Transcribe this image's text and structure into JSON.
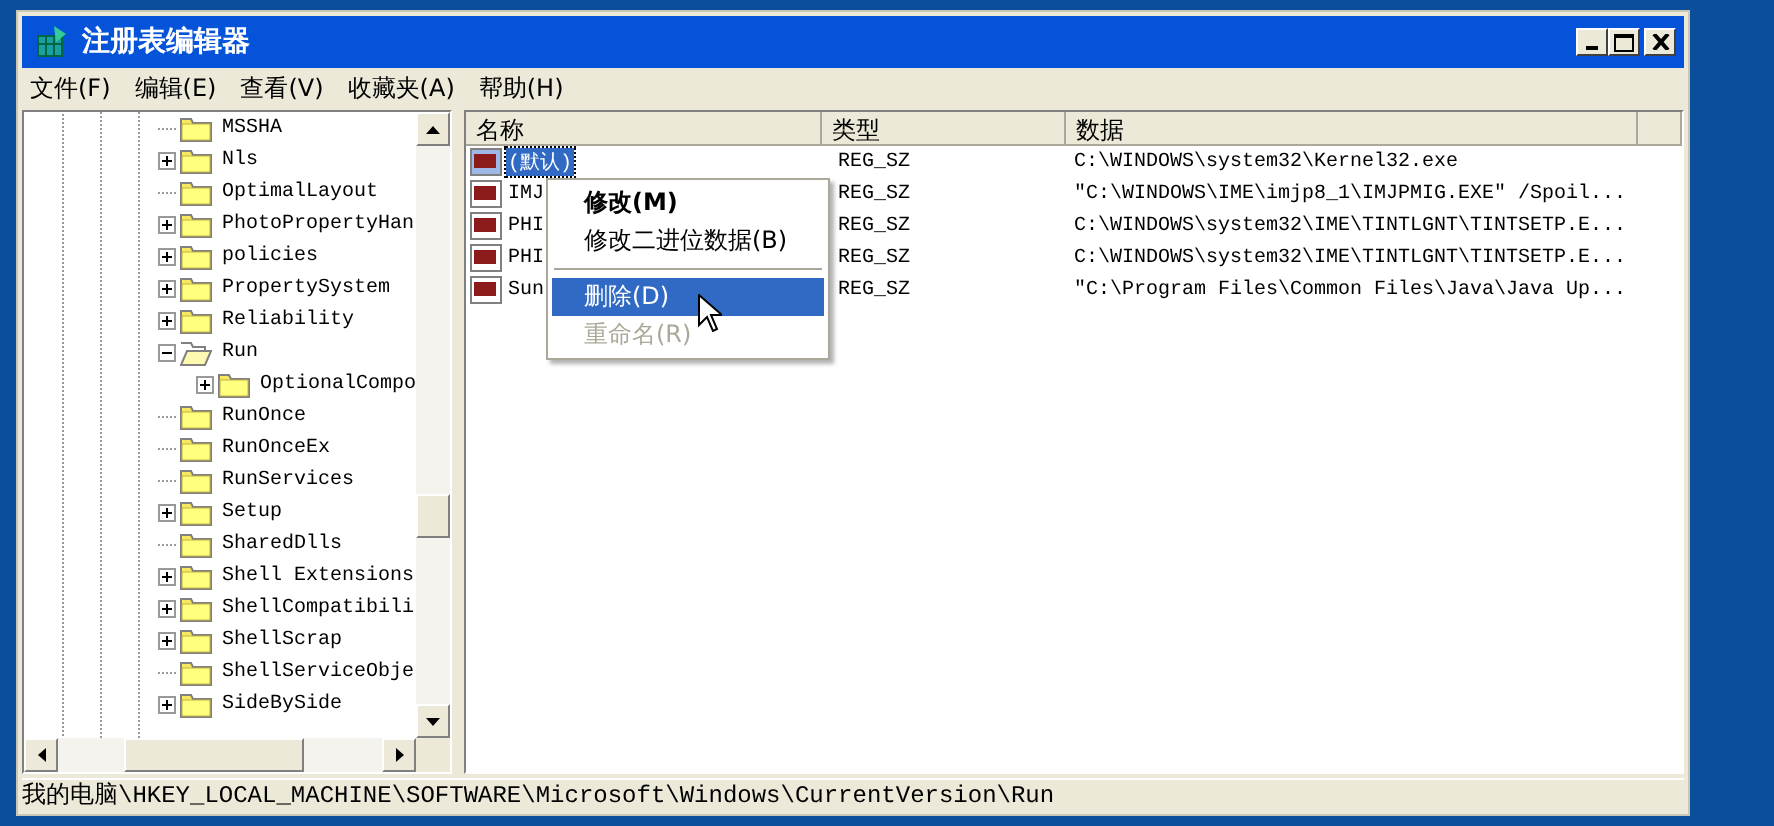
{
  "window": {
    "title": "注册表编辑器"
  },
  "menu": [
    {
      "label": "文件(F)"
    },
    {
      "label": "编辑(E)"
    },
    {
      "label": "查看(V)"
    },
    {
      "label": "收藏夹(A)"
    },
    {
      "label": "帮助(H)"
    }
  ],
  "tree": [
    {
      "label": "MSSHA"
    },
    {
      "label": "Nls",
      "expanded": false
    },
    {
      "label": "OptimalLayout"
    },
    {
      "label": "PhotoPropertyHan",
      "expanded": false
    },
    {
      "label": "policies",
      "expanded": false
    },
    {
      "label": "PropertySystem",
      "expanded": false
    },
    {
      "label": "Reliability",
      "expanded": false
    },
    {
      "label": "Run",
      "expanded": true,
      "children": [
        {
          "label": "OptionalCompo",
          "expanded": false
        }
      ]
    },
    {
      "label": "RunOnce"
    },
    {
      "label": "RunOnceEx"
    },
    {
      "label": "RunServices"
    },
    {
      "label": "Setup",
      "expanded": false
    },
    {
      "label": "SharedDlls"
    },
    {
      "label": "Shell Extensions",
      "expanded": false
    },
    {
      "label": "ShellCompatibili",
      "expanded": false
    },
    {
      "label": "ShellScrap",
      "expanded": false
    },
    {
      "label": "ShellServiceObje"
    },
    {
      "label": "SideBySide",
      "expanded": false
    }
  ],
  "table": {
    "columns": [
      "名称",
      "类型",
      "数据"
    ],
    "rows": [
      {
        "name": "(默认)",
        "type": "REG_SZ",
        "data": "C:\\WINDOWS\\system32\\Kernel32.exe",
        "selected": true
      },
      {
        "name": "IMJ",
        "type": "REG_SZ",
        "data": "\"C:\\WINDOWS\\IME\\imjp8_1\\IMJPMIG.EXE\" /Spoil...",
        "selected": false
      },
      {
        "name": "PHI",
        "type": "REG_SZ",
        "data": "C:\\WINDOWS\\system32\\IME\\TINTLGNT\\TINTSETP.E...",
        "selected": false
      },
      {
        "name": "PHI",
        "type": "REG_SZ",
        "data": "C:\\WINDOWS\\system32\\IME\\TINTLGNT\\TINTSETP.E...",
        "selected": false
      },
      {
        "name": "Sun",
        "type": "REG_SZ",
        "data": "\"C:\\Program Files\\Common Files\\Java\\Java Up...",
        "selected": false
      }
    ]
  },
  "context_menu": [
    {
      "kind": "item",
      "label": "修改(M)",
      "default": true,
      "selected": false,
      "disabled": false
    },
    {
      "kind": "item",
      "label": "修改二进位数据(B)",
      "default": false,
      "selected": false,
      "disabled": false
    },
    {
      "kind": "separator"
    },
    {
      "kind": "item",
      "label": "删除(D)",
      "default": false,
      "selected": true,
      "disabled": false
    },
    {
      "kind": "item",
      "label": "重命名(R)",
      "default": false,
      "selected": false,
      "disabled": true
    }
  ],
  "status_bar": "我的电脑\\HKEY_LOCAL_MACHINE\\SOFTWARE\\Microsoft\\Windows\\CurrentVersion\\Run"
}
